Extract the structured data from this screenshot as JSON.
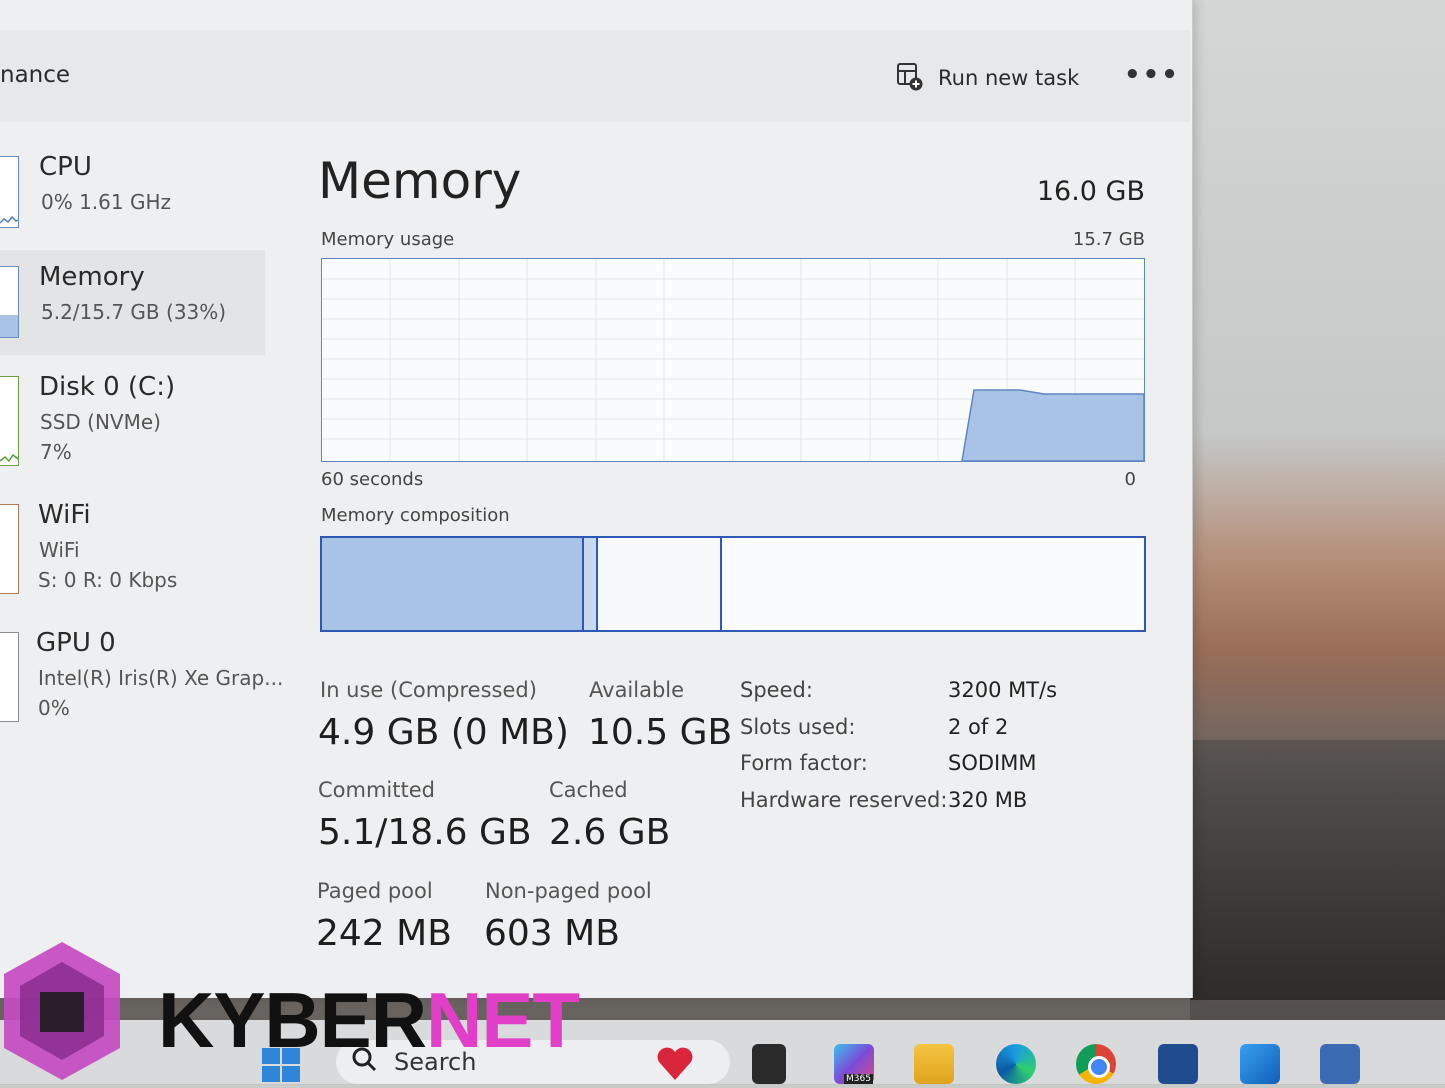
{
  "header": {
    "page_title": "nance",
    "run_new_task": "Run new task",
    "more": "•••"
  },
  "sidebar": {
    "items": [
      {
        "name": "CPU",
        "line1": "0%  1.61 GHz",
        "line2": ""
      },
      {
        "name": "Memory",
        "line1": "5.2/15.7 GB (33%)",
        "line2": ""
      },
      {
        "name": "Disk 0 (C:)",
        "line1": "SSD (NVMe)",
        "line2": "7%"
      },
      {
        "name": "WiFi",
        "line1": "WiFi",
        "line2": "S: 0  R: 0 Kbps"
      },
      {
        "name": "GPU 0",
        "line1": "Intel(R) Iris(R) Xe Grap...",
        "line2": "0%"
      }
    ]
  },
  "main": {
    "title": "Memory",
    "total": "16.0 GB",
    "usage_label": "Memory usage",
    "usage_max": "15.7 GB",
    "axis_left": "60 seconds",
    "axis_right": "0",
    "composition_label": "Memory composition",
    "stats": {
      "in_use_label": "In use (Compressed)",
      "in_use_value": "4.9 GB (0 MB)",
      "available_label": "Available",
      "available_value": "10.5 GB",
      "committed_label": "Committed",
      "committed_value": "5.1/18.6 GB",
      "cached_label": "Cached",
      "cached_value": "2.6 GB",
      "paged_label": "Paged pool",
      "paged_value": "242 MB",
      "nonpaged_label": "Non-paged pool",
      "nonpaged_value": "603 MB"
    },
    "specs": [
      {
        "label": "Speed:",
        "value": "3200 MT/s"
      },
      {
        "label": "Slots used:",
        "value": "2 of 2"
      },
      {
        "label": "Form factor:",
        "value": "SODIMM"
      },
      {
        "label": "Hardware reserved:",
        "value": "320 MB"
      }
    ]
  },
  "watermark": {
    "part1": "KYBER",
    "part2": "NET"
  },
  "taskbar": {
    "search_text": "Search",
    "app_icons": [
      "heart-app-icon",
      "file-app-icon",
      "m365-icon",
      "file-explorer-icon",
      "edge-icon",
      "chrome-icon",
      "store-icon",
      "outlook-icon",
      "task-manager-icon"
    ],
    "m365_badge": "M365"
  },
  "colors": {
    "accent": "#2c59b6",
    "graph_fill": "#a9c3e6",
    "graph_line": "#5f86c0"
  }
}
